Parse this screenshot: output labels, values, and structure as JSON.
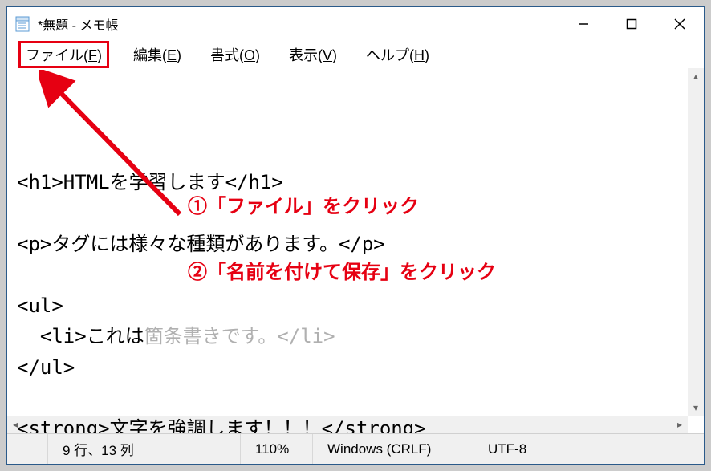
{
  "window": {
    "title": "*無題 - メモ帳"
  },
  "menu": {
    "file": "ファイル(",
    "file_key": "F",
    "file_close": ")",
    "edit": "編集(",
    "edit_key": "E",
    "edit_close": ")",
    "format": "書式(",
    "format_key": "O",
    "format_close": ")",
    "view": "表示(",
    "view_key": "V",
    "view_close": ")",
    "help": "ヘルプ(",
    "help_key": "H",
    "help_close": ")"
  },
  "editor": {
    "line1": "<h1>HTMLを学習します</h1>",
    "line2": "",
    "line3": "<p>タグには様々な種類があります。</p>",
    "line4": "",
    "line5": "<ul>",
    "line6a": "  <li>これは",
    "line6b": "箇条書きです。</li>",
    "line7": "</ul>",
    "line8": "",
    "line9": "<strong>文字を強調します！！！</strong>"
  },
  "annotations": {
    "step1": "①「ファイル」をクリック",
    "step2": "②「名前を付けて保存」をクリック"
  },
  "status": {
    "position": "9 行、13 列",
    "zoom": "110%",
    "line_ending": "Windows (CRLF)",
    "encoding": "UTF-8"
  }
}
